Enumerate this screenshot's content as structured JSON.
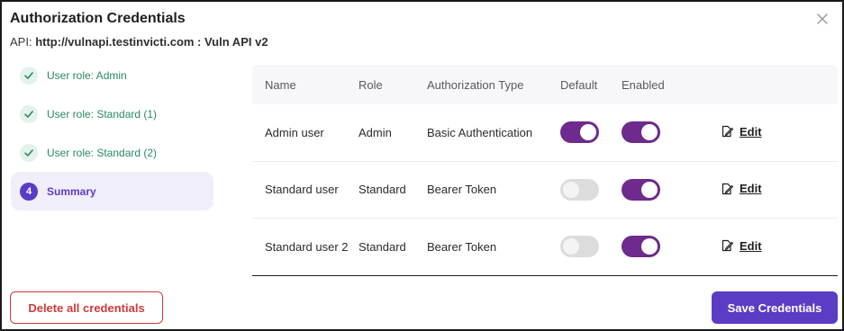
{
  "dialog": {
    "title": "Authorization Credentials",
    "api_label": "API:",
    "api_value": "http://vulnapi.testinvicti.com : Vuln API v2"
  },
  "stepper": {
    "steps": [
      {
        "label": "User role: Admin",
        "state": "done"
      },
      {
        "label": "User role: Standard (1)",
        "state": "done"
      },
      {
        "label": "User role: Standard (2)",
        "state": "done"
      },
      {
        "label": "Summary",
        "state": "active",
        "number": "4"
      }
    ]
  },
  "table": {
    "headers": {
      "name": "Name",
      "role": "Role",
      "type": "Authorization Type",
      "default": "Default",
      "enabled": "Enabled"
    },
    "rows": [
      {
        "name": "Admin user",
        "role": "Admin",
        "type": "Basic Authentication",
        "default": true,
        "enabled": true,
        "action": "Edit"
      },
      {
        "name": "Standard user",
        "role": "Standard",
        "type": "Bearer Token",
        "default": false,
        "enabled": true,
        "action": "Edit"
      },
      {
        "name": "Standard user 2",
        "role": "Standard",
        "type": "Bearer Token",
        "default": false,
        "enabled": true,
        "action": "Edit"
      }
    ]
  },
  "footer": {
    "delete_label": "Delete all credentials",
    "save_label": "Save Credentials"
  },
  "colors": {
    "accent": "#5b3cc4",
    "toggle_on": "#6e2a8c",
    "toggle_off": "#dcdcdc",
    "success": "#2a8a62",
    "danger": "#cf3b3b"
  },
  "icons": {
    "close": "close-icon",
    "step_done": "check-icon",
    "edit": "edit-icon"
  }
}
